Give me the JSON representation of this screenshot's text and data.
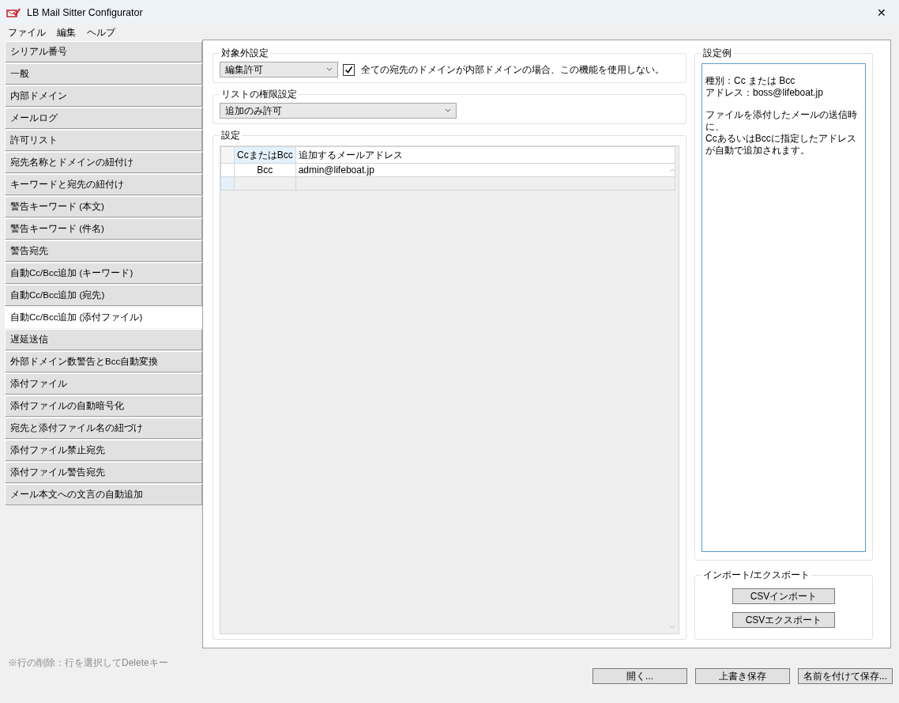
{
  "window": {
    "title": "LB Mail Sitter Configurator",
    "close": "✕"
  },
  "menu": [
    "ファイル",
    "編集",
    "ヘルプ"
  ],
  "sidebar": {
    "items": [
      {
        "label": "シリアル番号",
        "selected": false
      },
      {
        "label": "一般",
        "selected": false
      },
      {
        "label": "内部ドメイン",
        "selected": false
      },
      {
        "label": "メールログ",
        "selected": false
      },
      {
        "label": "許可リスト",
        "selected": false
      },
      {
        "label": "宛先名称とドメインの紐付け",
        "selected": false
      },
      {
        "label": "キーワードと宛先の紐付け",
        "selected": false
      },
      {
        "label": "警告キーワード (本文)",
        "selected": false
      },
      {
        "label": "警告キーワード (件名)",
        "selected": false
      },
      {
        "label": "警告宛先",
        "selected": false
      },
      {
        "label": "自動Cc/Bcc追加 (キーワード)",
        "selected": false
      },
      {
        "label": "自動Cc/Bcc追加 (宛先)",
        "selected": false
      },
      {
        "label": "自動Cc/Bcc追加 (添付ファイル)",
        "selected": true
      },
      {
        "label": "遅延送信",
        "selected": false
      },
      {
        "label": "外部ドメイン数警告とBcc自動変換",
        "selected": false
      },
      {
        "label": "添付ファイル",
        "selected": false
      },
      {
        "label": "添付ファイルの自動暗号化",
        "selected": false
      },
      {
        "label": "宛先と添付ファイル名の紐づけ",
        "selected": false
      },
      {
        "label": "添付ファイル禁止宛先",
        "selected": false
      },
      {
        "label": "添付ファイル警告宛先",
        "selected": false
      },
      {
        "label": "メール本文への文言の自動追加",
        "selected": false
      }
    ]
  },
  "exclusion": {
    "title": "対象外設定",
    "dropdown": "編集許可",
    "checkbox": {
      "label": "全ての宛先のドメインが内部ドメインの場合、この機能を使用しない。",
      "checked": true
    }
  },
  "permission": {
    "title": "リストの権限設定",
    "dropdown": "追加のみ許可"
  },
  "settings": {
    "title": "設定",
    "table": {
      "columns": [
        "CcまたはBcc",
        "追加するメールアドレス"
      ],
      "rows": [
        [
          "Bcc",
          "admin@lifeboat.jp"
        ]
      ]
    }
  },
  "example": {
    "title": "設定例",
    "paragraphs": [
      [
        "種別：Cc または Bcc",
        "アドレス：boss@lifeboat.jp"
      ],
      [
        "ファイルを添付したメールの送信時に、",
        "CcあるいはBccに指定したアドレスが自動で追加されます。"
      ]
    ]
  },
  "import_export": {
    "title": "インポート/エクスポート",
    "buttons": [
      "CSVインポート",
      "CSVエクスポート"
    ]
  },
  "footer": {
    "note": "※行の削除：行を選択してDeleteキー",
    "buttons": [
      "開く...",
      "上書き保存",
      "名前を付けて保存..."
    ]
  }
}
